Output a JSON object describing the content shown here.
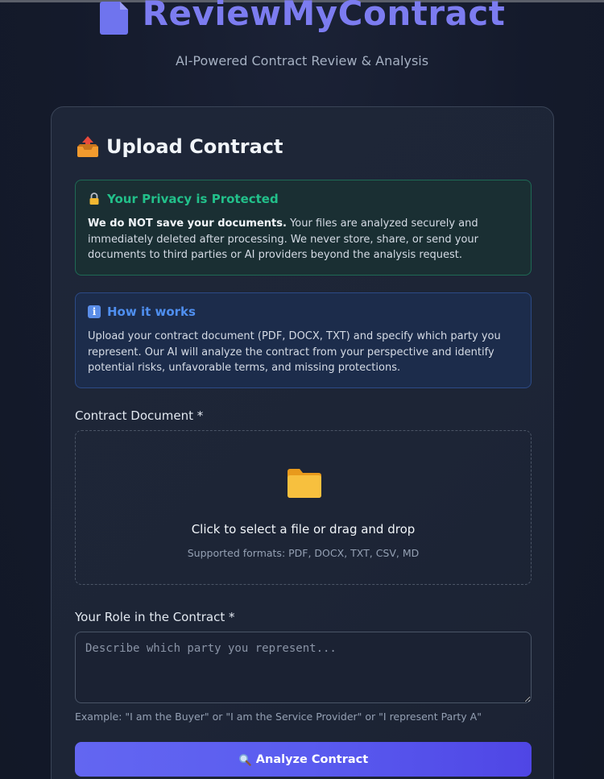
{
  "header": {
    "title": "ReviewMyContract",
    "subtitle": "AI-Powered Contract Review & Analysis",
    "logo_icon": "document-icon"
  },
  "card": {
    "title": "Upload Contract",
    "title_icon": "outbox-tray-icon"
  },
  "privacy": {
    "heading": "Your Privacy is Protected",
    "bold_lead": "We do NOT save your documents.",
    "body": "Your files are analyzed securely and immediately deleted after processing. We never store, share, or send your documents to third parties or AI providers beyond the analysis request.",
    "icon": "lock-icon",
    "accent": "#22c08a"
  },
  "how": {
    "heading": "How it works",
    "body": "Upload your contract document (PDF, DOCX, TXT) and specify which party you represent. Our AI will analyze the contract from your perspective and identify potential risks, unfavorable terms, and missing protections.",
    "icon": "info-icon",
    "accent": "#4f8ff0"
  },
  "document": {
    "label": "Contract Document *",
    "drop_text": "Click to select a file or drag and drop",
    "formats": "Supported formats: PDF, DOCX, TXT, CSV, MD",
    "icon": "folder-icon"
  },
  "role": {
    "label": "Your Role in the Contract *",
    "placeholder": "Describe which party you represent...",
    "value": "",
    "hint": "Example: \"I am the Buyer\" or \"I am the Service Provider\" or \"I represent Party A\""
  },
  "submit": {
    "label": "Analyze Contract",
    "icon": "search-icon",
    "color": "#6366f1"
  }
}
